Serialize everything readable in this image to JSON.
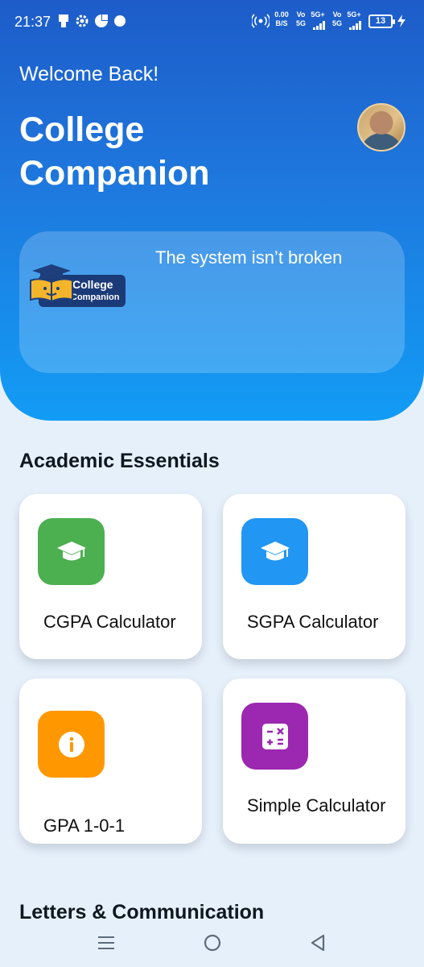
{
  "status_bar": {
    "time": "21:37",
    "net_speed_value": "0.00",
    "net_speed_unit": "B/S",
    "sim1_top": "Vo",
    "sim1_bottom": "5G",
    "sim1_net": "5G+",
    "sim2_top": "Vo",
    "sim2_bottom": "5G",
    "sim2_net": "5G+",
    "battery": "13"
  },
  "header": {
    "welcome": "Welcome Back!",
    "title": "College Companion",
    "avatar_icon": "profile-avatar"
  },
  "banner": {
    "text": "The system isn’t broken",
    "logo_line1": "College",
    "logo_line2": "Companion"
  },
  "academic": {
    "heading": "Academic Essentials",
    "cards": [
      {
        "label": "CGPA Calculator",
        "icon": "graduation-cap-icon",
        "color": "#4caf50"
      },
      {
        "label": "SGPA Calculator",
        "icon": "graduation-cap-icon",
        "color": "#2196f3"
      },
      {
        "label": "GPA 1-0-1",
        "icon": "info-icon",
        "color": "#ff9800"
      },
      {
        "label": "Simple Calculator",
        "icon": "calculator-icon",
        "color": "#9c27b0"
      }
    ]
  },
  "letters": {
    "heading": "Letters & Communication"
  },
  "nav": {
    "menu_icon": "menu-icon",
    "home_icon": "home-icon",
    "back_icon": "back-icon"
  }
}
